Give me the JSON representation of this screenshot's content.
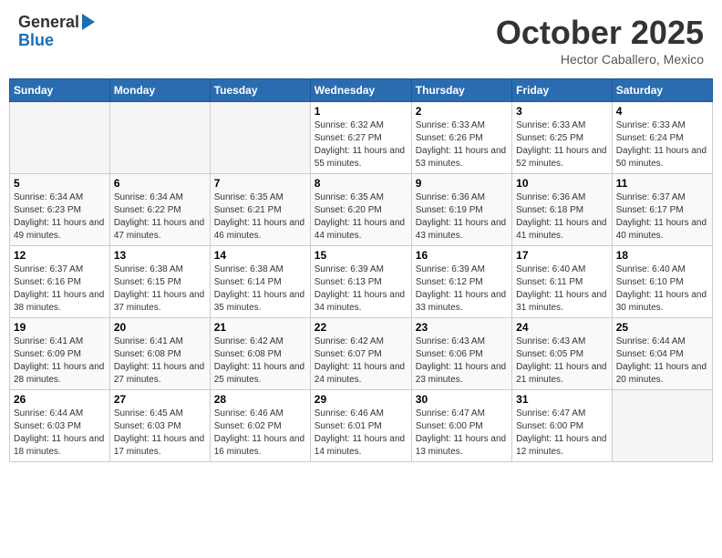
{
  "header": {
    "logo_general": "General",
    "logo_blue": "Blue",
    "month": "October 2025",
    "location": "Hector Caballero, Mexico"
  },
  "days_of_week": [
    "Sunday",
    "Monday",
    "Tuesday",
    "Wednesday",
    "Thursday",
    "Friday",
    "Saturday"
  ],
  "weeks": [
    [
      {
        "day": "",
        "sunrise": "",
        "sunset": "",
        "daylight": ""
      },
      {
        "day": "",
        "sunrise": "",
        "sunset": "",
        "daylight": ""
      },
      {
        "day": "",
        "sunrise": "",
        "sunset": "",
        "daylight": ""
      },
      {
        "day": "1",
        "sunrise": "Sunrise: 6:32 AM",
        "sunset": "Sunset: 6:27 PM",
        "daylight": "Daylight: 11 hours and 55 minutes."
      },
      {
        "day": "2",
        "sunrise": "Sunrise: 6:33 AM",
        "sunset": "Sunset: 6:26 PM",
        "daylight": "Daylight: 11 hours and 53 minutes."
      },
      {
        "day": "3",
        "sunrise": "Sunrise: 6:33 AM",
        "sunset": "Sunset: 6:25 PM",
        "daylight": "Daylight: 11 hours and 52 minutes."
      },
      {
        "day": "4",
        "sunrise": "Sunrise: 6:33 AM",
        "sunset": "Sunset: 6:24 PM",
        "daylight": "Daylight: 11 hours and 50 minutes."
      }
    ],
    [
      {
        "day": "5",
        "sunrise": "Sunrise: 6:34 AM",
        "sunset": "Sunset: 6:23 PM",
        "daylight": "Daylight: 11 hours and 49 minutes."
      },
      {
        "day": "6",
        "sunrise": "Sunrise: 6:34 AM",
        "sunset": "Sunset: 6:22 PM",
        "daylight": "Daylight: 11 hours and 47 minutes."
      },
      {
        "day": "7",
        "sunrise": "Sunrise: 6:35 AM",
        "sunset": "Sunset: 6:21 PM",
        "daylight": "Daylight: 11 hours and 46 minutes."
      },
      {
        "day": "8",
        "sunrise": "Sunrise: 6:35 AM",
        "sunset": "Sunset: 6:20 PM",
        "daylight": "Daylight: 11 hours and 44 minutes."
      },
      {
        "day": "9",
        "sunrise": "Sunrise: 6:36 AM",
        "sunset": "Sunset: 6:19 PM",
        "daylight": "Daylight: 11 hours and 43 minutes."
      },
      {
        "day": "10",
        "sunrise": "Sunrise: 6:36 AM",
        "sunset": "Sunset: 6:18 PM",
        "daylight": "Daylight: 11 hours and 41 minutes."
      },
      {
        "day": "11",
        "sunrise": "Sunrise: 6:37 AM",
        "sunset": "Sunset: 6:17 PM",
        "daylight": "Daylight: 11 hours and 40 minutes."
      }
    ],
    [
      {
        "day": "12",
        "sunrise": "Sunrise: 6:37 AM",
        "sunset": "Sunset: 6:16 PM",
        "daylight": "Daylight: 11 hours and 38 minutes."
      },
      {
        "day": "13",
        "sunrise": "Sunrise: 6:38 AM",
        "sunset": "Sunset: 6:15 PM",
        "daylight": "Daylight: 11 hours and 37 minutes."
      },
      {
        "day": "14",
        "sunrise": "Sunrise: 6:38 AM",
        "sunset": "Sunset: 6:14 PM",
        "daylight": "Daylight: 11 hours and 35 minutes."
      },
      {
        "day": "15",
        "sunrise": "Sunrise: 6:39 AM",
        "sunset": "Sunset: 6:13 PM",
        "daylight": "Daylight: 11 hours and 34 minutes."
      },
      {
        "day": "16",
        "sunrise": "Sunrise: 6:39 AM",
        "sunset": "Sunset: 6:12 PM",
        "daylight": "Daylight: 11 hours and 33 minutes."
      },
      {
        "day": "17",
        "sunrise": "Sunrise: 6:40 AM",
        "sunset": "Sunset: 6:11 PM",
        "daylight": "Daylight: 11 hours and 31 minutes."
      },
      {
        "day": "18",
        "sunrise": "Sunrise: 6:40 AM",
        "sunset": "Sunset: 6:10 PM",
        "daylight": "Daylight: 11 hours and 30 minutes."
      }
    ],
    [
      {
        "day": "19",
        "sunrise": "Sunrise: 6:41 AM",
        "sunset": "Sunset: 6:09 PM",
        "daylight": "Daylight: 11 hours and 28 minutes."
      },
      {
        "day": "20",
        "sunrise": "Sunrise: 6:41 AM",
        "sunset": "Sunset: 6:08 PM",
        "daylight": "Daylight: 11 hours and 27 minutes."
      },
      {
        "day": "21",
        "sunrise": "Sunrise: 6:42 AM",
        "sunset": "Sunset: 6:08 PM",
        "daylight": "Daylight: 11 hours and 25 minutes."
      },
      {
        "day": "22",
        "sunrise": "Sunrise: 6:42 AM",
        "sunset": "Sunset: 6:07 PM",
        "daylight": "Daylight: 11 hours and 24 minutes."
      },
      {
        "day": "23",
        "sunrise": "Sunrise: 6:43 AM",
        "sunset": "Sunset: 6:06 PM",
        "daylight": "Daylight: 11 hours and 23 minutes."
      },
      {
        "day": "24",
        "sunrise": "Sunrise: 6:43 AM",
        "sunset": "Sunset: 6:05 PM",
        "daylight": "Daylight: 11 hours and 21 minutes."
      },
      {
        "day": "25",
        "sunrise": "Sunrise: 6:44 AM",
        "sunset": "Sunset: 6:04 PM",
        "daylight": "Daylight: 11 hours and 20 minutes."
      }
    ],
    [
      {
        "day": "26",
        "sunrise": "Sunrise: 6:44 AM",
        "sunset": "Sunset: 6:03 PM",
        "daylight": "Daylight: 11 hours and 18 minutes."
      },
      {
        "day": "27",
        "sunrise": "Sunrise: 6:45 AM",
        "sunset": "Sunset: 6:03 PM",
        "daylight": "Daylight: 11 hours and 17 minutes."
      },
      {
        "day": "28",
        "sunrise": "Sunrise: 6:46 AM",
        "sunset": "Sunset: 6:02 PM",
        "daylight": "Daylight: 11 hours and 16 minutes."
      },
      {
        "day": "29",
        "sunrise": "Sunrise: 6:46 AM",
        "sunset": "Sunset: 6:01 PM",
        "daylight": "Daylight: 11 hours and 14 minutes."
      },
      {
        "day": "30",
        "sunrise": "Sunrise: 6:47 AM",
        "sunset": "Sunset: 6:00 PM",
        "daylight": "Daylight: 11 hours and 13 minutes."
      },
      {
        "day": "31",
        "sunrise": "Sunrise: 6:47 AM",
        "sunset": "Sunset: 6:00 PM",
        "daylight": "Daylight: 11 hours and 12 minutes."
      },
      {
        "day": "",
        "sunrise": "",
        "sunset": "",
        "daylight": ""
      }
    ]
  ]
}
